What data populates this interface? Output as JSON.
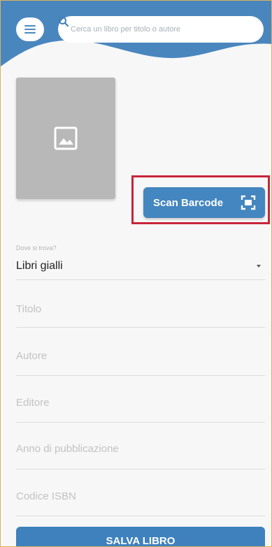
{
  "header": {
    "menu_icon": "menu-icon",
    "search": {
      "placeholder": "Cerca un libro per titolo o autore",
      "icon": "search-icon"
    }
  },
  "cover": {
    "icon": "image-icon"
  },
  "scan": {
    "label": "Scan Barcode",
    "icon": "barcode-scan-icon"
  },
  "form": {
    "location": {
      "label": "Dove si trova?",
      "value": "Libri gialli"
    },
    "fields": [
      {
        "placeholder": "Titolo"
      },
      {
        "placeholder": "Autore"
      },
      {
        "placeholder": "Editore"
      },
      {
        "placeholder": "Anno di pubblicazione"
      },
      {
        "placeholder": "Codice ISBN"
      }
    ],
    "save_label": "SALVA LIBRO"
  },
  "colors": {
    "header": "#4a86be",
    "accent": "#4486bf",
    "highlight": "#c8253a"
  }
}
